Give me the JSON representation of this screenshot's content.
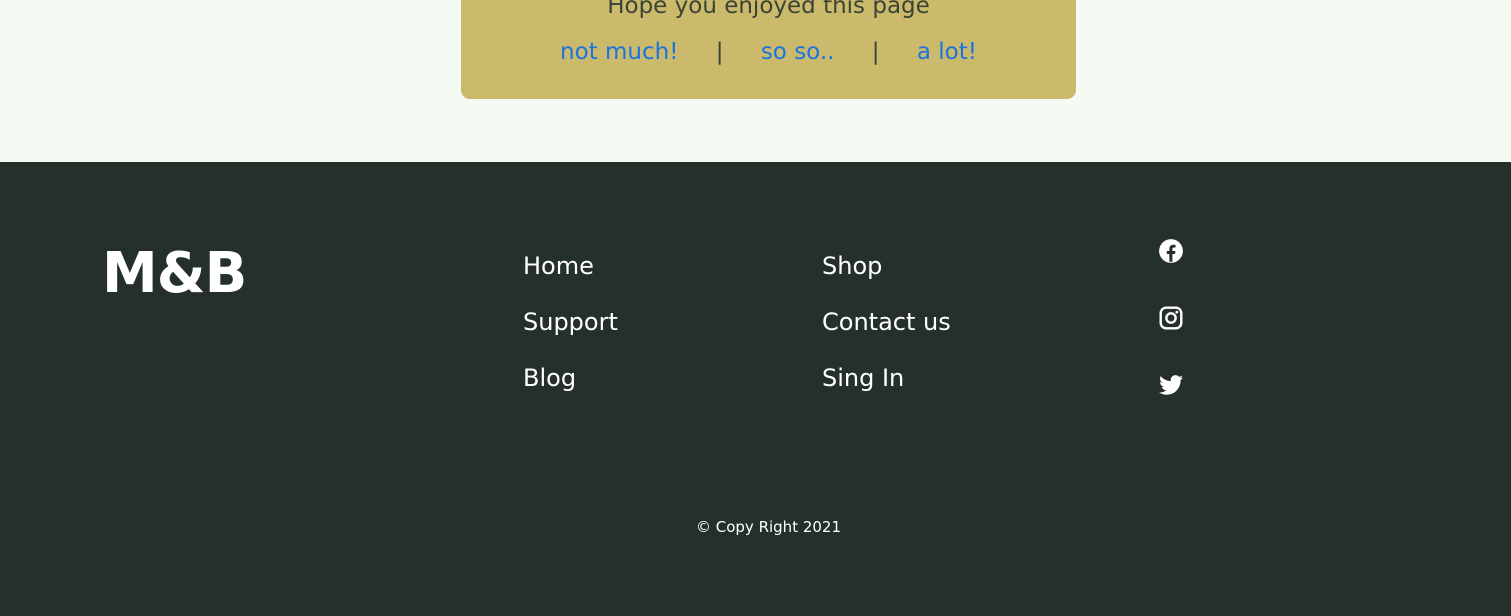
{
  "feedback": {
    "title": "Hope you enjoyed this page",
    "options": [
      "not much!",
      "so so..",
      "a lot!"
    ],
    "separator": "|"
  },
  "footer": {
    "brand": "M&B",
    "nav_col1": [
      "Home",
      "Support",
      "Blog"
    ],
    "nav_col2": [
      "Shop",
      "Contact us",
      "Sing In"
    ],
    "social_icons": [
      "facebook-icon",
      "instagram-icon",
      "twitter-icon"
    ],
    "copyright": "© Copy Right 2021"
  },
  "colors": {
    "page_bg": "#f5faf2",
    "feedback_bg": "#cbba6c",
    "link_blue": "#1a74e0",
    "footer_bg": "#25302a",
    "text_dark": "#3a4336"
  }
}
